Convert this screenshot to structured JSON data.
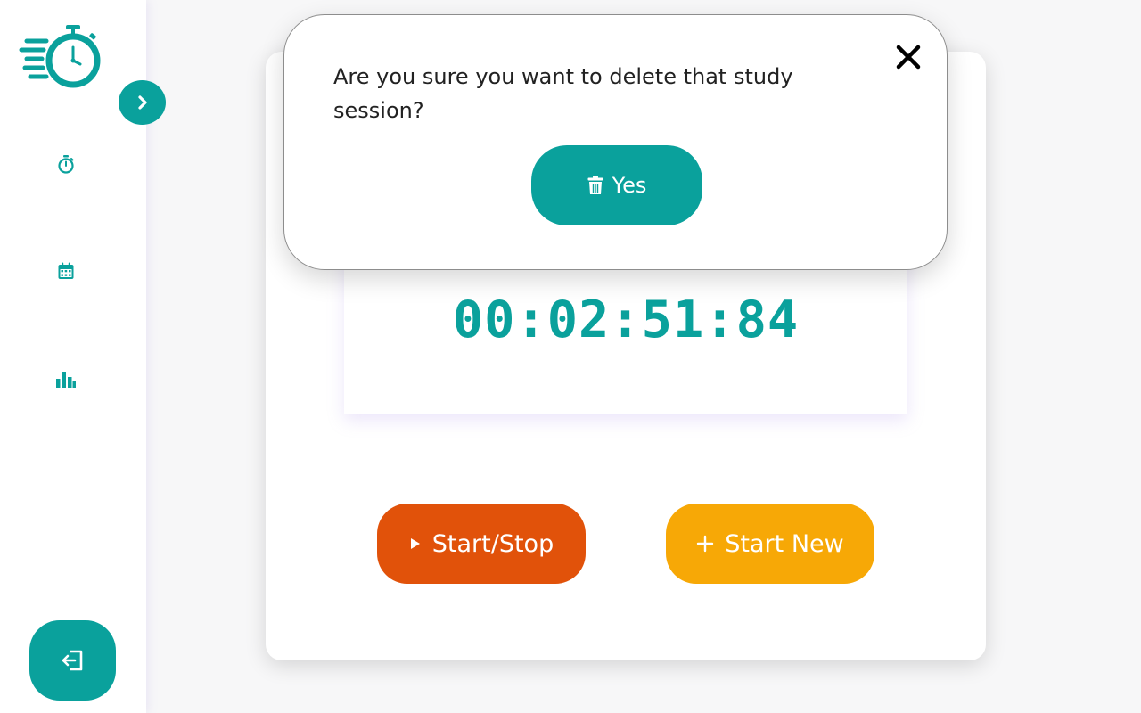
{
  "colors": {
    "accent": "#0aa19c",
    "start_stop": "#e1520a",
    "start_new": "#f7a806",
    "background": "#f7f7f8"
  },
  "sidebar": {
    "logo_icon": "stopwatch-logo-icon",
    "toggle_icon": "chevron-right-icon",
    "nav_items": [
      {
        "icon": "stopwatch-icon"
      },
      {
        "icon": "calendar-icon"
      },
      {
        "icon": "bar-chart-icon"
      }
    ],
    "logout_icon": "logout-icon"
  },
  "timer": {
    "display": "00:02:51:84"
  },
  "buttons": {
    "start_stop_icon": "play-icon",
    "start_stop_label": "Start/Stop",
    "start_new_icon": "plus-icon",
    "start_new_label": "Start New"
  },
  "modal": {
    "message": "Are you sure you want to delete that study session?",
    "close_icon": "close-icon",
    "confirm_icon": "trash-icon",
    "confirm_label": "Yes"
  }
}
